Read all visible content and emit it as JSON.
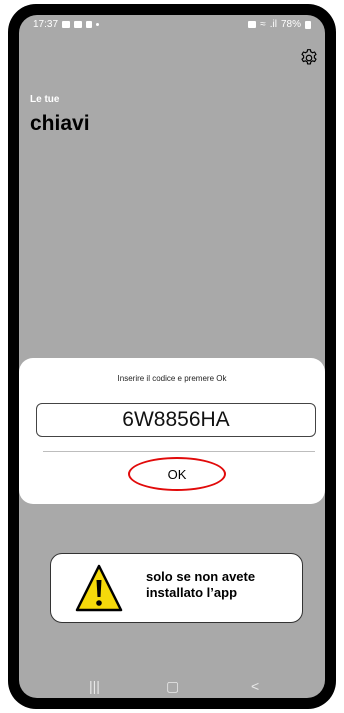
{
  "statusbar": {
    "time": "17:37",
    "battery": "78%"
  },
  "header": {
    "subtitle": "Le tue",
    "title": "chiavi"
  },
  "dialog": {
    "message": "Inserire il codice e premere Ok",
    "code": "6W8856HA",
    "ok_label": "OK"
  },
  "warning": {
    "line1": "solo se non avete",
    "line2": "installato l’app"
  },
  "navbar": {
    "recent": "|||",
    "home": "▢",
    "back": "<"
  },
  "colors": {
    "background": "#a9a9a9",
    "highlight_ring": "#e10a0a",
    "warning_yellow": "#f5d90b"
  }
}
